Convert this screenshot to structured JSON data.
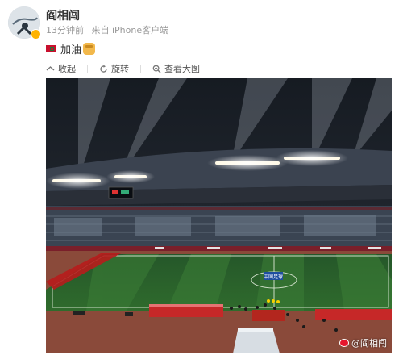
{
  "post": {
    "username": "阎相闯",
    "time": "13分钟前",
    "source": "来自 iPhone客户端",
    "text": "加油",
    "text_icons": [
      "flag-icon",
      "fist-emoji-icon"
    ]
  },
  "toolbar": {
    "collect_label": "收起",
    "rotate_label": "旋转",
    "view_large_label": "查看大图"
  },
  "photo": {
    "watermark": "@阎相闯",
    "board_text": "中国足球"
  },
  "colors": {
    "username": "#333333",
    "meta": "#999999",
    "pitch": "#2f6b2c",
    "track": "#8a4a3a",
    "flag_red": "#c8102e",
    "weibo_red": "#e6162d"
  }
}
